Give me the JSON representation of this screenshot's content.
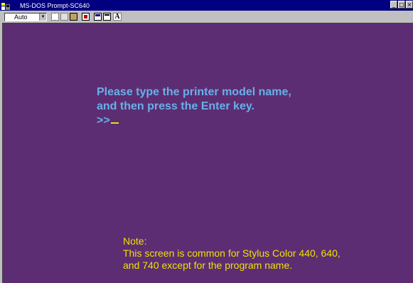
{
  "window": {
    "title": "MS-DOS Prompt-SC640",
    "buttons": {
      "minimize": "_",
      "maximize": "□",
      "close": "×"
    }
  },
  "toolbar": {
    "font_size_value": "Auto",
    "font_label": "A",
    "icons": [
      "mark-icon",
      "copy-icon",
      "paste-icon",
      "full-screen-icon",
      "properties-icon",
      "background-icon",
      "font-icon"
    ]
  },
  "console": {
    "prompt_lines": [
      "Please type the printer model name,",
      "and then press the Enter key."
    ],
    "prompt_marker": ">>",
    "note_lines": [
      "Note:",
      "This screen is common for Stylus Color 440, 640,",
      "and 740 except for the program name."
    ]
  },
  "colors": {
    "console_bg": "#5c2d73",
    "prompt_text": "#68b0e8",
    "note_text": "#f0e000",
    "titlebar": "#000080"
  }
}
